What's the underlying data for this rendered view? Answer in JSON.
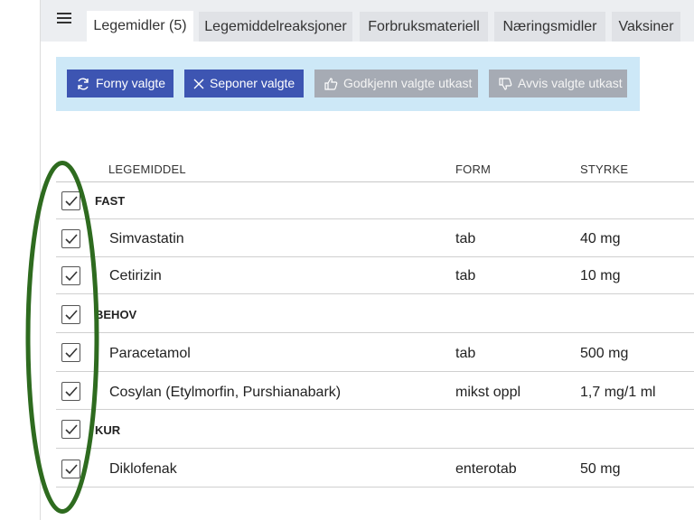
{
  "tabs": [
    {
      "label": "Legemidler (5)",
      "active": true
    },
    {
      "label": "Legemiddelreaksjoner",
      "active": false
    },
    {
      "label": "Forbruksmateriell",
      "active": false
    },
    {
      "label": "Næringsmidler",
      "active": false
    },
    {
      "label": "Vaksiner",
      "active": false
    }
  ],
  "toolbar": {
    "renew_label": "Forny valgte",
    "discontinue_label": "Seponer valgte",
    "approve_label": "Godkjenn valgte utkast",
    "reject_label": "Avvis valgte utkast"
  },
  "table": {
    "columns": [
      "LEGEMIDDEL",
      "FORM",
      "STYRKE"
    ],
    "groups": [
      {
        "label": "FAST",
        "checked": true,
        "rows": [
          {
            "name": "Simvastatin",
            "form": "tab",
            "strength": "40 mg",
            "checked": true
          },
          {
            "name": "Cetirizin",
            "form": "tab",
            "strength": "10 mg",
            "checked": true
          }
        ]
      },
      {
        "label": "BEHOV",
        "checked": true,
        "rows": [
          {
            "name": "Paracetamol",
            "form": "tab",
            "strength": "500 mg",
            "checked": true
          },
          {
            "name": "Cosylan (Etylmorfin, Purshianabark)",
            "form": "mikst oppl",
            "strength": "1,7 mg/1 ml",
            "checked": true
          }
        ]
      },
      {
        "label": "KUR",
        "checked": true,
        "rows": [
          {
            "name": "Diklofenak",
            "form": "enterotab",
            "strength": "50 mg",
            "checked": true
          }
        ]
      }
    ]
  },
  "colors": {
    "primary_button": "#3d55b2",
    "disabled_button": "#a6abb4",
    "toolbar_bg": "#cde8f7",
    "annotation": "#2e6b1f"
  },
  "icons": [
    "menu-icon",
    "refresh-icon",
    "close-icon",
    "thumbs-up-icon",
    "thumbs-down-icon",
    "checkmark-icon"
  ]
}
